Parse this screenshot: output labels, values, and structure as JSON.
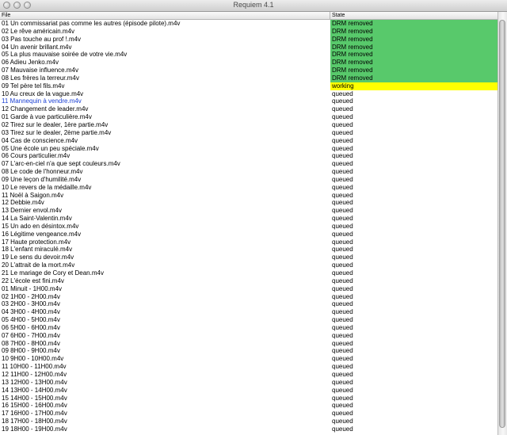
{
  "window": {
    "title": "Requiem 4.1"
  },
  "colors": {
    "drm_removed": "#58c96b",
    "working": "#ffff00",
    "selected_text": "#1a3fd3"
  },
  "table": {
    "columns": [
      "File",
      "State"
    ],
    "rows": [
      {
        "file": "01 Un commissariat pas comme les autres (épisode pilote).m4v",
        "state": "DRM removed"
      },
      {
        "file": "02 Le rêve américain.m4v",
        "state": "DRM removed"
      },
      {
        "file": "03 Pas touche au prof !.m4v",
        "state": "DRM removed"
      },
      {
        "file": "04 Un avenir brillant.m4v",
        "state": "DRM removed"
      },
      {
        "file": "05 La plus mauvaise soirée de votre vie.m4v",
        "state": "DRM removed"
      },
      {
        "file": "06 Adieu Jenko.m4v",
        "state": "DRM removed"
      },
      {
        "file": "07 Mauvaise influence.m4v",
        "state": "DRM removed"
      },
      {
        "file": "08 Les frères la terreur.m4v",
        "state": "DRM removed"
      },
      {
        "file": "09 Tel père tel fils.m4v",
        "state": "working"
      },
      {
        "file": "10 Au creux de la vague.m4v",
        "state": "queued"
      },
      {
        "file": "11 Mannequin à vendre.m4v",
        "state": "queued",
        "selected": true
      },
      {
        "file": "12 Changement de leader.m4v",
        "state": "queued"
      },
      {
        "file": "01 Garde à vue particulière.m4v",
        "state": "queued"
      },
      {
        "file": "02 Tirez sur le dealer, 1ère partie.m4v",
        "state": "queued"
      },
      {
        "file": "03 Tirez sur le dealer, 2ème partie.m4v",
        "state": "queued"
      },
      {
        "file": "04 Cas de conscience.m4v",
        "state": "queued"
      },
      {
        "file": "05 Une école un peu spéciale.m4v",
        "state": "queued"
      },
      {
        "file": "06 Cours particulier.m4v",
        "state": "queued"
      },
      {
        "file": "07 L'arc-en-ciel n'a que sept couleurs.m4v",
        "state": "queued"
      },
      {
        "file": "08 Le code de l'honneur.m4v",
        "state": "queued"
      },
      {
        "file": "09 Une leçon d'humilité.m4v",
        "state": "queued"
      },
      {
        "file": "10 Le revers de la médaille.m4v",
        "state": "queued"
      },
      {
        "file": "11 Noël à Saigon.m4v",
        "state": "queued"
      },
      {
        "file": "12 Debbie.m4v",
        "state": "queued"
      },
      {
        "file": "13 Dernier envol.m4v",
        "state": "queued"
      },
      {
        "file": "14 La Saint-Valentin.m4v",
        "state": "queued"
      },
      {
        "file": "15 Un ado en désintox.m4v",
        "state": "queued"
      },
      {
        "file": "16 Légitime vengeance.m4v",
        "state": "queued"
      },
      {
        "file": "17 Haute protection.m4v",
        "state": "queued"
      },
      {
        "file": "18 L'enfant miraculé.m4v",
        "state": "queued"
      },
      {
        "file": "19 Le sens du devoir.m4v",
        "state": "queued"
      },
      {
        "file": "20 L'attrait de la mort.m4v",
        "state": "queued"
      },
      {
        "file": "21 Le mariage de Cory et Dean.m4v",
        "state": "queued"
      },
      {
        "file": "22 L'école est fini.m4v",
        "state": "queued"
      },
      {
        "file": "01 Minuit - 1H00.m4v",
        "state": "queued"
      },
      {
        "file": "02 1H00 - 2H00.m4v",
        "state": "queued"
      },
      {
        "file": "03 2H00 - 3H00.m4v",
        "state": "queued"
      },
      {
        "file": "04 3H00 - 4H00.m4v",
        "state": "queued"
      },
      {
        "file": "05 4H00 - 5H00.m4v",
        "state": "queued"
      },
      {
        "file": "06 5H00 - 6H00.m4v",
        "state": "queued"
      },
      {
        "file": "07 6H00 - 7H00.m4v",
        "state": "queued"
      },
      {
        "file": "08 7H00 - 8H00.m4v",
        "state": "queued"
      },
      {
        "file": "09 8H00 - 9H00.m4v",
        "state": "queued"
      },
      {
        "file": "10 9H00 - 10H00.m4v",
        "state": "queued"
      },
      {
        "file": "11 10H00 - 11H00.m4v",
        "state": "queued"
      },
      {
        "file": "12 11H00 - 12H00.m4v",
        "state": "queued"
      },
      {
        "file": "13 12H00 - 13H00.m4v",
        "state": "queued"
      },
      {
        "file": "14 13H00 - 14H00.m4v",
        "state": "queued"
      },
      {
        "file": "15 14H00 - 15H00.m4v",
        "state": "queued"
      },
      {
        "file": "16 15H00 - 16H00.m4v",
        "state": "queued"
      },
      {
        "file": "17 16H00 - 17H00.m4v",
        "state": "queued"
      },
      {
        "file": "18 17H00 - 18H00.m4v",
        "state": "queued"
      },
      {
        "file": "19 18H00 - 19H00.m4v",
        "state": "queued"
      }
    ]
  }
}
